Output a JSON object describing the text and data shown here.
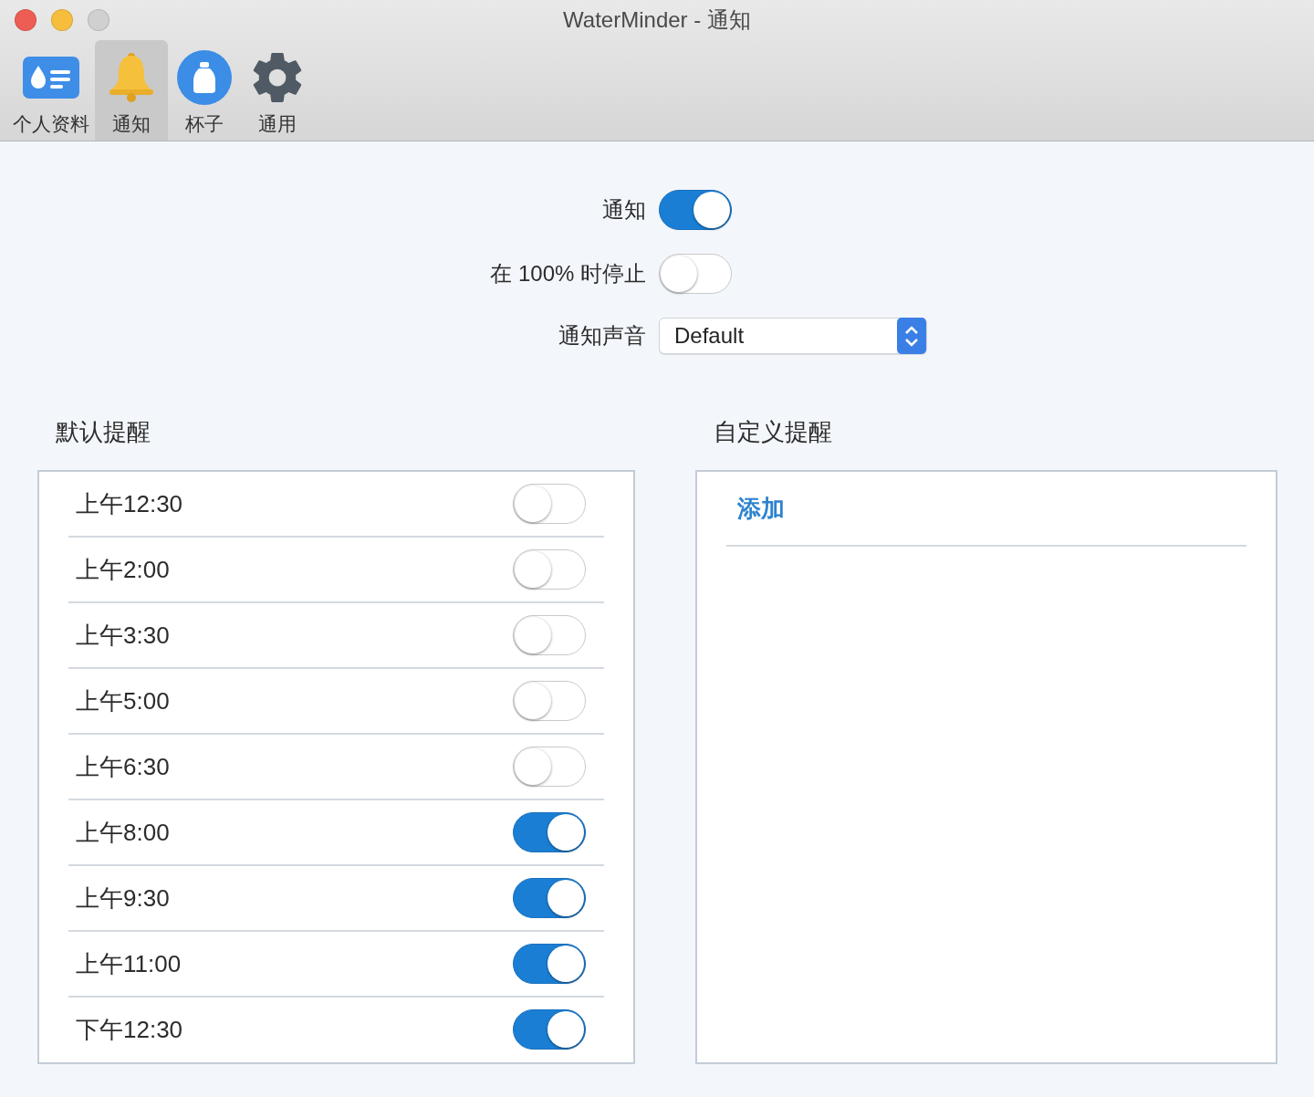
{
  "window": {
    "title": "WaterMinder - 通知"
  },
  "toolbar": [
    {
      "label": "个人资料",
      "kind": "profile",
      "selected": false
    },
    {
      "label": "通知",
      "kind": "bell",
      "selected": true
    },
    {
      "label": "杯子",
      "kind": "cup",
      "selected": false
    },
    {
      "label": "通用",
      "kind": "gear",
      "selected": false
    }
  ],
  "settings": [
    {
      "label": "通知",
      "kind": "toggle",
      "on": true
    },
    {
      "label": "在 100% 时停止",
      "kind": "toggle",
      "on": false
    },
    {
      "label": "通知声音",
      "kind": "select",
      "value": "Default"
    }
  ],
  "default_reminders": {
    "title": "默认提醒",
    "items": [
      {
        "time": "上午12:30",
        "on": false
      },
      {
        "time": "上午2:00",
        "on": false
      },
      {
        "time": "上午3:30",
        "on": false
      },
      {
        "time": "上午5:00",
        "on": false
      },
      {
        "time": "上午6:30",
        "on": false
      },
      {
        "time": "上午8:00",
        "on": true
      },
      {
        "time": "上午9:30",
        "on": true
      },
      {
        "time": "上午11:00",
        "on": true
      },
      {
        "time": "下午12:30",
        "on": true
      }
    ]
  },
  "custom_reminders": {
    "title": "自定义提醒",
    "add_link": "添加"
  }
}
